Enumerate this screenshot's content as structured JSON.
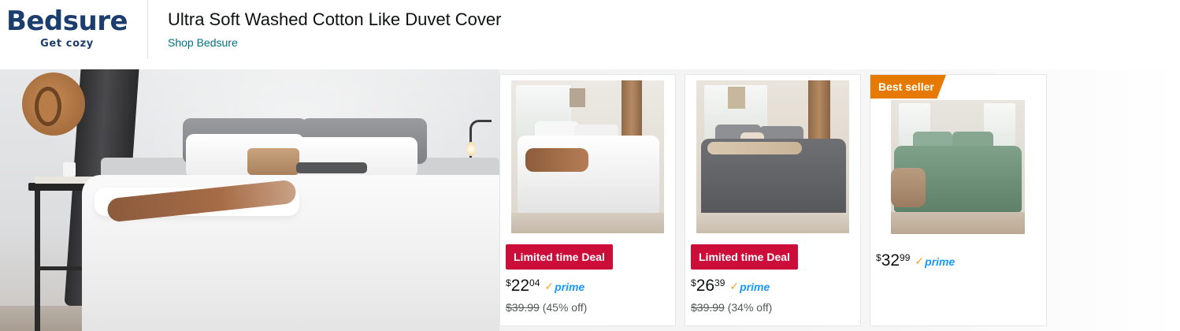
{
  "brand": {
    "logo_text": "Bedsure",
    "tagline": "Get cozy",
    "color": "#1c3e6e"
  },
  "header": {
    "title": "Ultra Soft Washed Cotton Like Duvet Cover",
    "shop_link": "Shop Bedsure",
    "link_color": "#007185"
  },
  "hero": {
    "image": "white-duvet-bedroom-scene"
  },
  "products": [
    {
      "image": "white-duvet-cover-bed",
      "deal_label": "Limited time Deal",
      "price_currency": "$",
      "price_whole": "22",
      "price_fraction": "04",
      "prime_label": "prime",
      "list_price": "$39.99",
      "discount": "(45% off)"
    },
    {
      "image": "grey-duvet-cover-bed",
      "deal_label": "Limited time Deal",
      "price_currency": "$",
      "price_whole": "26",
      "price_fraction": "39",
      "prime_label": "prime",
      "list_price": "$39.99",
      "discount": "(34% off)"
    },
    {
      "image": "sage-green-duvet-cover-bed",
      "badge": "Best seller",
      "price_currency": "$",
      "price_whole": "32",
      "price_fraction": "99",
      "prime_label": "prime"
    }
  ],
  "colors": {
    "deal_red": "#cc0c39",
    "best_seller_orange": "#e67a00",
    "prime_blue": "#1a98ff",
    "prime_check": "#f5a623"
  }
}
